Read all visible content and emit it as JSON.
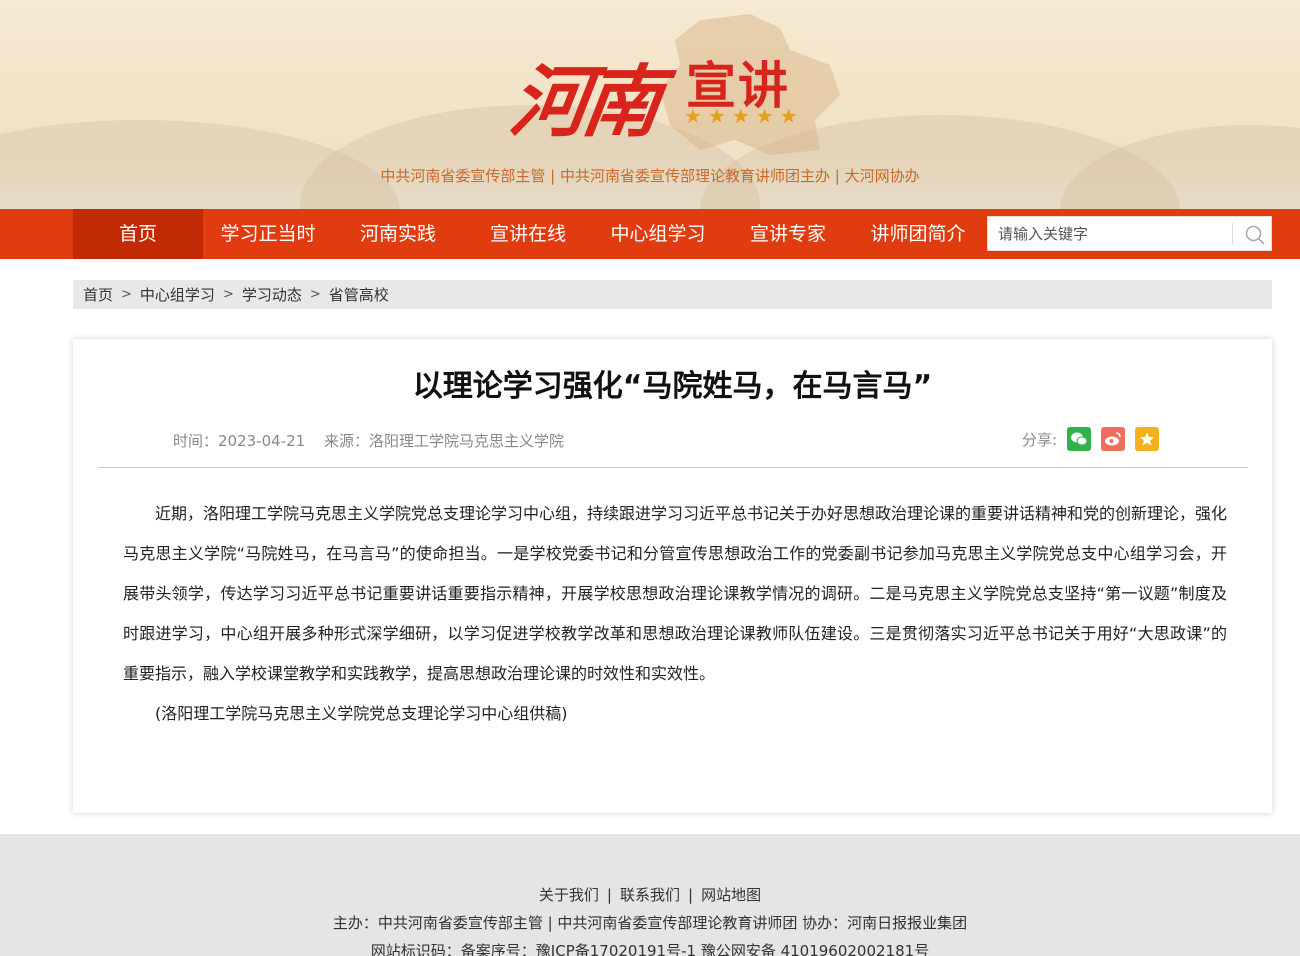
{
  "header": {
    "logo_main": "河南",
    "logo_sub": "宣讲",
    "stars": "★★★★★",
    "sponsors": "中共河南省委宣传部主管  |  中共河南省委宣传部理论教育讲师团主办  |  大河网协办"
  },
  "nav": {
    "items": [
      "首页",
      "学习正当时",
      "河南实践",
      "宣讲在线",
      "中心组学习",
      "宣讲专家",
      "讲师团简介"
    ],
    "search_placeholder": "请输入关键字"
  },
  "breadcrumb": [
    "首页",
    "中心组学习",
    "学习动态",
    "省管高校"
  ],
  "article": {
    "title": "以理论学习强化“马院姓马，在马言马”",
    "time_label": "时间：2023-04-21",
    "source_label": "来源：洛阳理工学院马克思主义学院",
    "share_label": "分享:",
    "paragraph": "近期，洛阳理工学院马克思主义学院党总支理论学习中心组，持续跟进学习习近平总书记关于办好思想政治理论课的重要讲话精神和党的创新理论，强化马克思主义学院“马院姓马，在马言马”的使命担当。一是学校党委书记和分管宣传思想政治工作的党委副书记参加马克思主义学院党总支中心组学习会，开展带头领学，传达学习习近平总书记重要讲话重要指示精神，开展学校思想政治理论课教学情况的调研。二是马克思主义学院党总支坚持“第一议题”制度及时跟进学习，中心组开展多种形式深学细研，以学习促进学校教学改革和思想政治理论课教师队伍建设。三是贯彻落实习近平总书记关于用好“大思政课”的重要指示，融入学校课堂教学和实践教学，提高思想政治理论课的时效性和实效性。",
    "credit": "(洛阳理工学院马克思主义学院党总支理论学习中心组供稿)"
  },
  "footer": {
    "links": [
      "关于我们",
      "联系我们",
      "网站地图"
    ],
    "host_line": "主办：中共河南省委宣传部主管 | 中共河南省委宣传部理论教育讲师团    协办：河南日报报业集团",
    "icp_line": "网站标识码：备案序号：豫ICP备17020191号-1    豫公网安备 41019602002181号"
  },
  "colors": {
    "nav_bg": "#e03c10",
    "nav_active": "#c22a06",
    "logo_red": "#d8251c",
    "star_gold": "#e4a21a",
    "sponsor_text": "#c9692a",
    "wechat": "#2fb34a",
    "weibo": "#f06d5e",
    "favorite": "#f3b121"
  }
}
